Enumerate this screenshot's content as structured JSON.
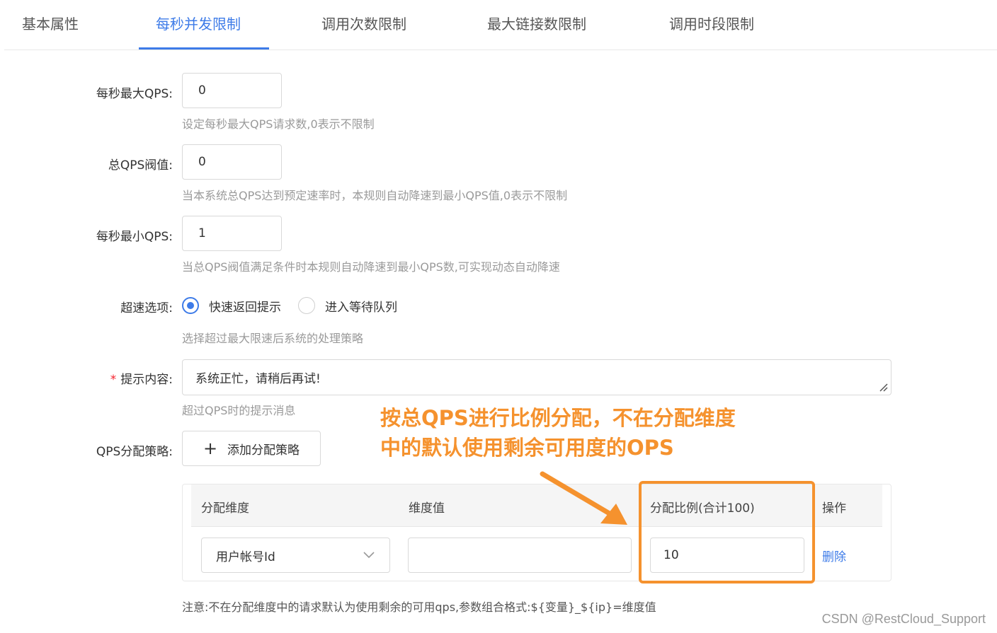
{
  "tabs": [
    {
      "label": "基本属性"
    },
    {
      "label": "每秒并发限制"
    },
    {
      "label": "调用次数限制"
    },
    {
      "label": "最大链接数限制"
    },
    {
      "label": "调用时段限制"
    }
  ],
  "form": {
    "max_qps": {
      "label": "每秒最大QPS:",
      "value": "0",
      "help": "设定每秒最大QPS请求数,0表示不限制"
    },
    "total_qps": {
      "label": "总QPS阀值:",
      "value": "0",
      "help": "当本系统总QPS达到预定速率时，本规则自动降速到最小QPS值,0表示不限制"
    },
    "min_qps": {
      "label": "每秒最小QPS:",
      "value": "1",
      "help": "当总QPS阀值满足条件时本规则自动降速到最小QPS数,可实现动态自动降速"
    },
    "overspeed": {
      "label": "超速选项:",
      "options": [
        "快速返回提示",
        "进入等待队列"
      ],
      "selected": "快速返回提示",
      "help": "选择超过最大限速后系统的处理策略"
    },
    "prompt": {
      "label": "提示内容:",
      "required": "*",
      "value": "系统正忙，请稍后再试!",
      "help": "超过QPS时的提示消息"
    },
    "strategy": {
      "label": "QPS分配策略:",
      "add_button": "添加分配策略"
    }
  },
  "annotation": {
    "line1": "按总QPS进行比例分配，不在分配维度",
    "line2": "中的默认使用剩余可用度的OPS"
  },
  "table": {
    "columns": [
      "分配维度",
      "维度值",
      "分配比例(合计100)",
      "操作"
    ],
    "rows": [
      {
        "dimension": "用户帐号Id",
        "dimension_value": "",
        "ratio": "10",
        "action": "删除"
      }
    ]
  },
  "note": "注意:不在分配维度中的请求默认为使用剩余的可用qps,参数组合格式:${变量}_${ip}=维度值",
  "watermark": "CSDN @RestCloud_Support",
  "colors": {
    "accent": "#3d7be8",
    "annotation": "#f5922e",
    "required": "#f5222d"
  }
}
